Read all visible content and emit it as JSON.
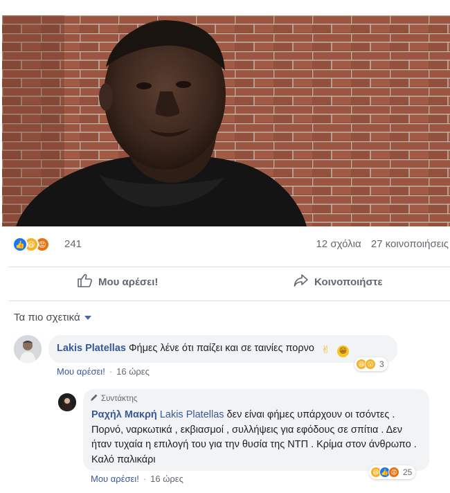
{
  "post": {
    "reactions": {
      "icons": [
        "like",
        "haha",
        "angry"
      ],
      "count": "241"
    },
    "comments_count": "12 σχόλια",
    "shares_count": "27 κοινοποιήσεις"
  },
  "actions": {
    "like_label": "Μου αρέσει!",
    "share_label": "Κοινοποιήστε"
  },
  "sort": {
    "label": "Τα πιο σχετικά"
  },
  "comments": [
    {
      "author": "Lakis Platellas",
      "text": "Φήμες λένε ότι παίζει και σε ταινίες πορνο",
      "trailing_emojis": [
        "victory-hand",
        "grinning-face"
      ],
      "reactions": {
        "icons": [
          "haha",
          "wow"
        ],
        "count": "3"
      },
      "like_label": "Μου αρέσει!",
      "separator": "·",
      "time": "16 ώρες"
    },
    {
      "badge": "Συντάκτης",
      "author": "Ραχήλ Μακρή",
      "mention": "Lakis Platellas",
      "text": " δεν είναι φήμες υπάρχουν οι τσόντες . Πορνό, ναρκωτικά , εκβιασμοί , συλλήψεις για εφόδους σε σπίτια . Δεν ήταν τυχαία η επιλογή του για την θυσία της ΝΤΠ . Κρίμα στον άνθρωπο . Καλό παλικάρι",
      "reactions": {
        "icons": [
          "haha",
          "like",
          "angry"
        ],
        "count": "25"
      },
      "like_label": "Μου αρέσει!",
      "separator": "·",
      "time": "16 ώρες"
    }
  ],
  "colors": {
    "link": "#385898",
    "muted": "#606770",
    "like_blue": "#1877f2",
    "haha_yellow": "#f7b125",
    "angry_orange": "#e9710f",
    "bubble_bg": "#f2f3f5"
  }
}
